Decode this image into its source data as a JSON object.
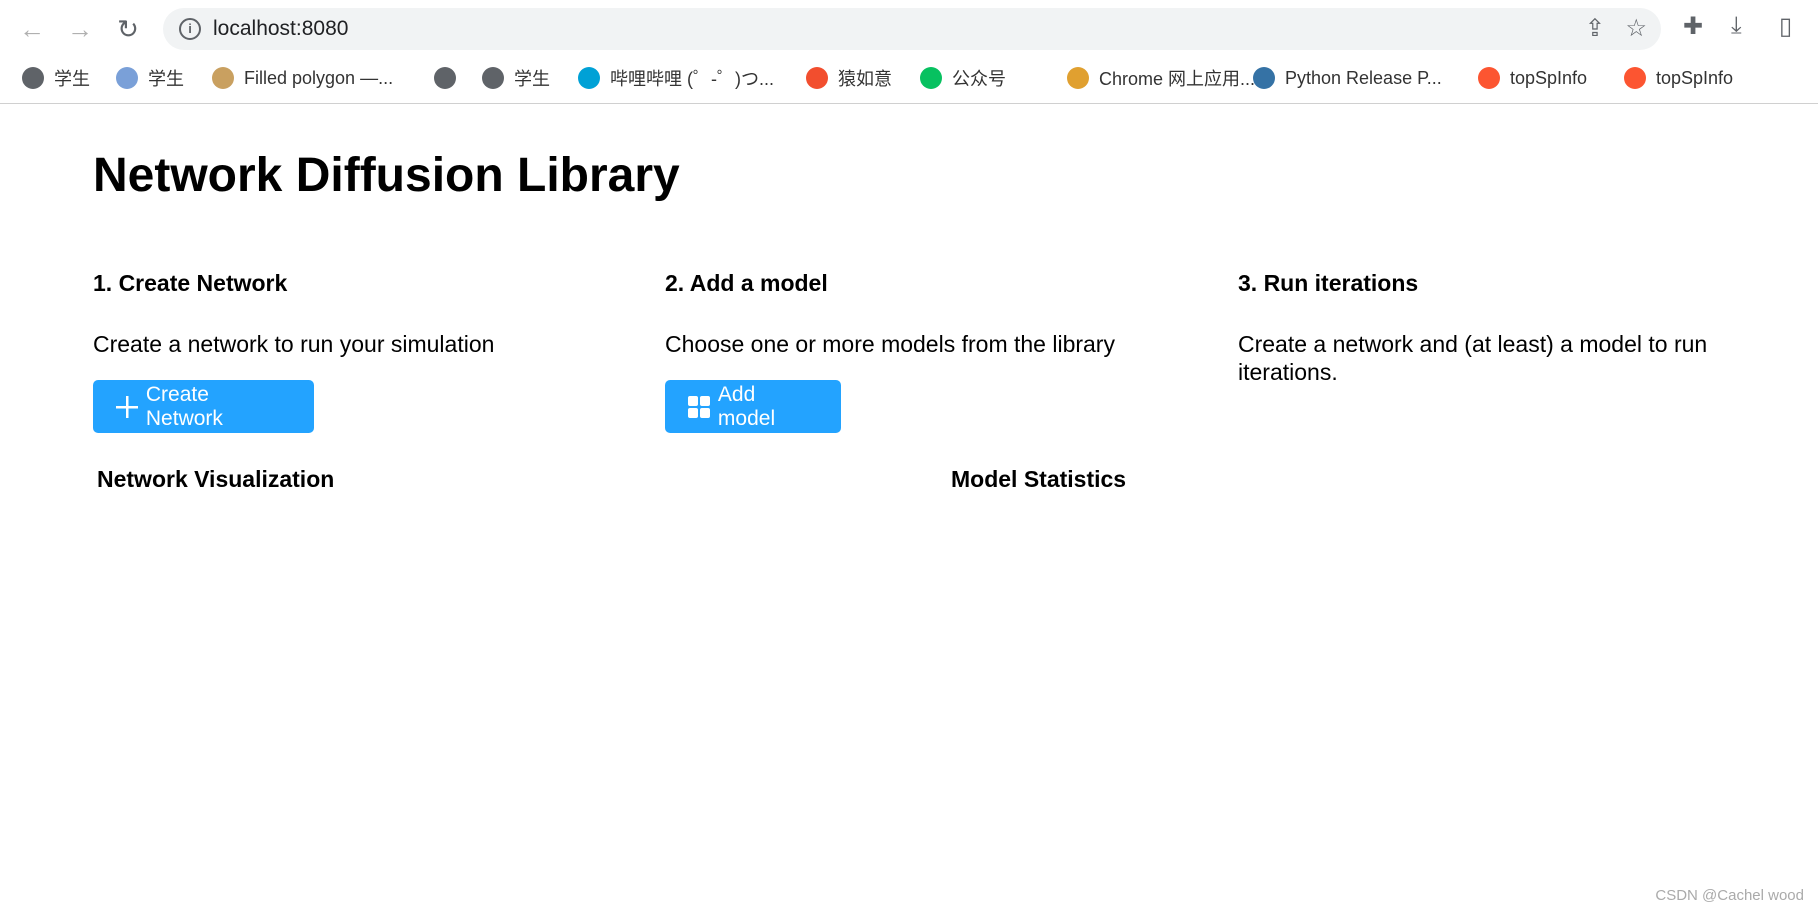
{
  "browser": {
    "url": "localhost:8080",
    "bookmarks": [
      {
        "label": "学生",
        "color": "#5f6368"
      },
      {
        "label": "学生",
        "color": "#7aa0d8"
      },
      {
        "label": "Filled polygon —...",
        "color": "#c9a060"
      },
      {
        "label": "",
        "color": "#5f6368"
      },
      {
        "label": "学生",
        "color": "#5f6368"
      },
      {
        "label": "哔哩哔哩 (゜-゜)つ...",
        "color": "#00a1d6"
      },
      {
        "label": "猿如意",
        "color": "#f24e2e"
      },
      {
        "label": "公众号",
        "color": "#07c160"
      },
      {
        "label": "Chrome 网上应用...",
        "color": "#e0a030"
      },
      {
        "label": "Python Release P...",
        "color": "#3572a5"
      },
      {
        "label": "topSpInfo",
        "color": "#fc5531"
      },
      {
        "label": "topSpInfo",
        "color": "#fc5531"
      }
    ]
  },
  "page": {
    "title": "Network Diffusion Library",
    "steps": [
      {
        "heading": "1. Create Network",
        "text": "Create a network to run your simulation",
        "button": "Create Network",
        "icon": "plus-icon"
      },
      {
        "heading": "2. Add a model",
        "text": "Choose one or more models from the library",
        "button": "Add model",
        "icon": "grid-icon"
      },
      {
        "heading": "3. Run iterations",
        "text": "Create a network and (at least) a model to run iterations."
      }
    ],
    "network_visualization": "Network Visualization",
    "model_statistics": "Model Statistics",
    "accent": "#23a3ff"
  },
  "watermark": "CSDN @Cachel wood"
}
